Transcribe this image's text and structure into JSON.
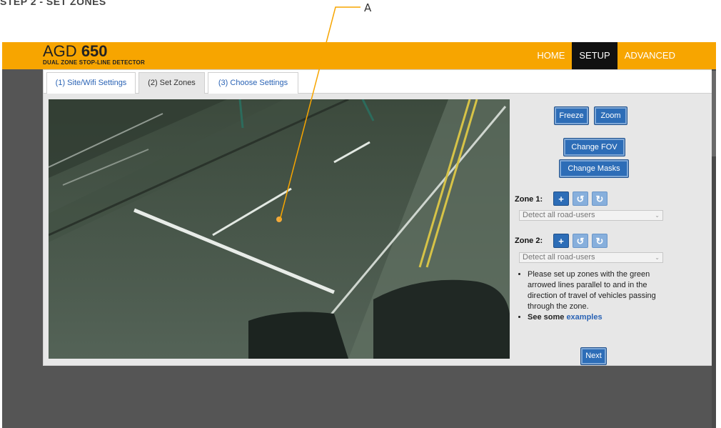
{
  "step_heading": "STEP 2 - SET ZONES",
  "callout": {
    "label": "A"
  },
  "logo": {
    "thin": "AGD",
    "bold": "650",
    "subtitle": "DUAL ZONE STOP-LINE DETECTOR"
  },
  "nav": [
    {
      "label": "HOME"
    },
    {
      "label": "SETUP"
    },
    {
      "label": "ADVANCED"
    }
  ],
  "tabs": [
    {
      "label": "(1) Site/Wifi Settings"
    },
    {
      "label": "(2) Set Zones"
    },
    {
      "label": "(3) Choose Settings"
    }
  ],
  "controls": {
    "freeze": "Freeze",
    "zoom": "Zoom",
    "change_fov": "Change FOV",
    "change_masks": "Change Masks",
    "zone1_label": "Zone 1:",
    "zone2_label": "Zone 2:",
    "zone1_select": "Detect all road-users",
    "zone2_select": "Detect all road-users",
    "add_icon": "+",
    "undo_icon": "↺",
    "redo_icon": "↻",
    "chevron": "⌄",
    "next": "Next"
  },
  "notes": {
    "item1": "Please set up zones with the green arrowed lines parallel to and in the direction of travel of vehicles passing through the zone.",
    "item2_prefix": "See some",
    "item2_link": "examples"
  },
  "colors": {
    "topbar": "#f7a500",
    "nav_active": "#111111",
    "button": "#2d6db7",
    "link": "#2a63b5",
    "callout_line": "#f7a500"
  }
}
